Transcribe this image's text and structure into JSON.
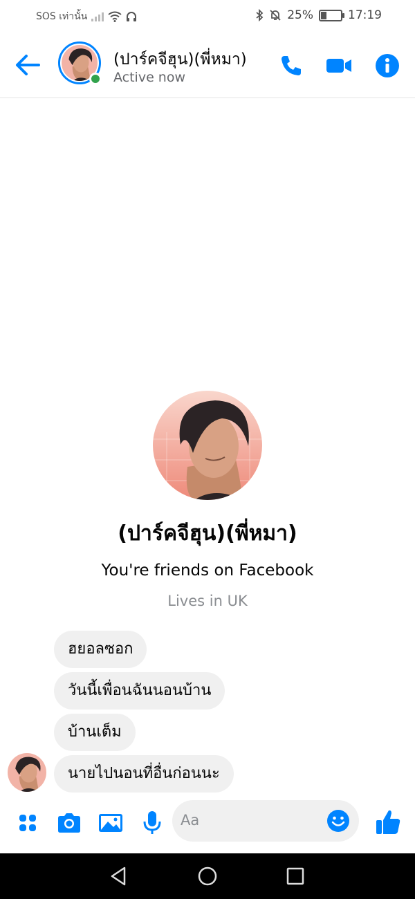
{
  "status_bar": {
    "carrier": "SOS เท่านั้น",
    "battery": "25%",
    "battery_level": 0.25,
    "time": "17:19"
  },
  "header": {
    "contact_name": "(ปาร์คจีฮุน)(พี่หมา)",
    "status": "Active now"
  },
  "profile": {
    "name": "(ปาร์คจีฮุน)(พี่หมา)",
    "friends_text": "You're friends on Facebook",
    "lives_in": "Lives in UK"
  },
  "messages": [
    {
      "text": "ฮยอลซอก"
    },
    {
      "text": "วันนี้เพื่อนฉันนอนบ้าน"
    },
    {
      "text": "บ้านเต็ม"
    },
    {
      "text": "นายไปนอนที่อื่นก่อนนะ"
    }
  ],
  "composer": {
    "placeholder": "Aa"
  },
  "colors": {
    "accent": "#0084ff",
    "online": "#31a24c",
    "bubble": "#f0f0f0"
  }
}
